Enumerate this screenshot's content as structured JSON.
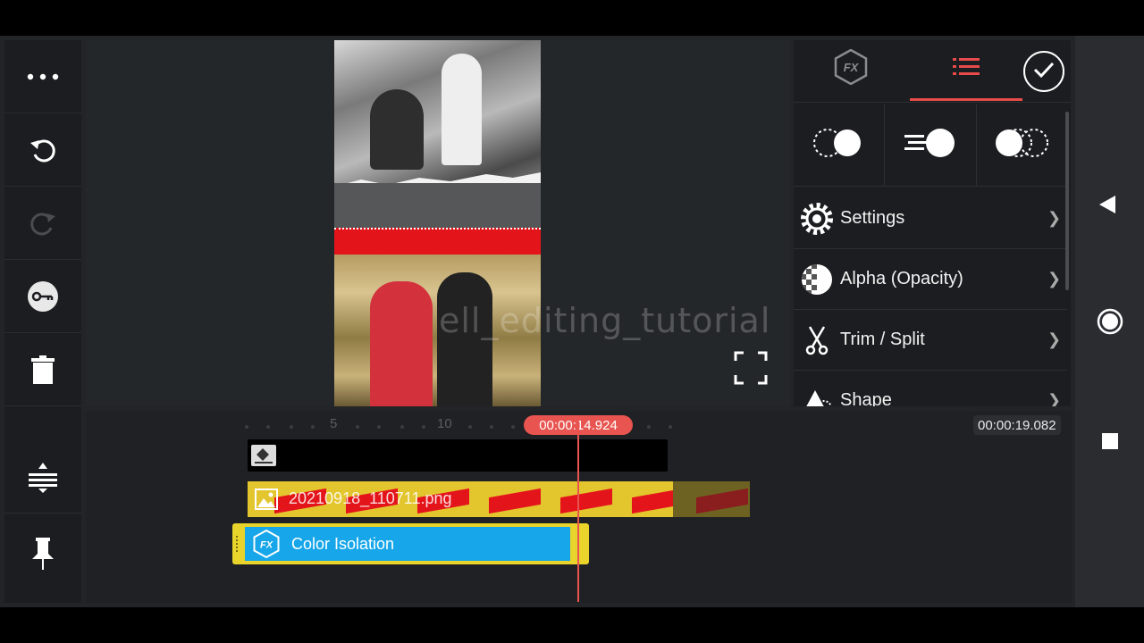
{
  "left_toolbar": {
    "items": [
      {
        "name": "more-icon"
      },
      {
        "name": "undo-icon"
      },
      {
        "name": "redo-icon"
      },
      {
        "name": "keyframe-key-icon"
      },
      {
        "name": "delete-icon"
      },
      {
        "name": "timeline-expand-icon"
      },
      {
        "name": "pin-icon"
      }
    ]
  },
  "preview": {
    "watermark": "ell_editing_tutorial"
  },
  "panel": {
    "tabs": [
      {
        "icon": "fx-icon",
        "label": "FX"
      },
      {
        "icon": "list-icon"
      }
    ],
    "blend_modes": [
      {
        "icon": "blend-mode-icon"
      },
      {
        "icon": "motion-blur-icon"
      },
      {
        "icon": "mask-circles-icon"
      }
    ],
    "menu": [
      {
        "label": "Settings",
        "icon": "gear-icon"
      },
      {
        "label": "Alpha (Opacity)",
        "icon": "checker-icon"
      },
      {
        "label": "Trim / Split",
        "icon": "scissors-icon"
      },
      {
        "label": "Shape",
        "icon": "shape-icon"
      }
    ]
  },
  "timeline": {
    "ruler_labels": [
      "5",
      "10"
    ],
    "current_time": "00:00:14.924",
    "end_time": "00:00:19.082",
    "tracks": {
      "png_layer": "20210918_110711.png",
      "effect_layer": "Color Isolation",
      "effect_icon_text": "FX"
    }
  },
  "colors": {
    "accent": "#e85550",
    "clip_yellow": "#e3c52e",
    "effect_blue": "#16a6e9"
  }
}
